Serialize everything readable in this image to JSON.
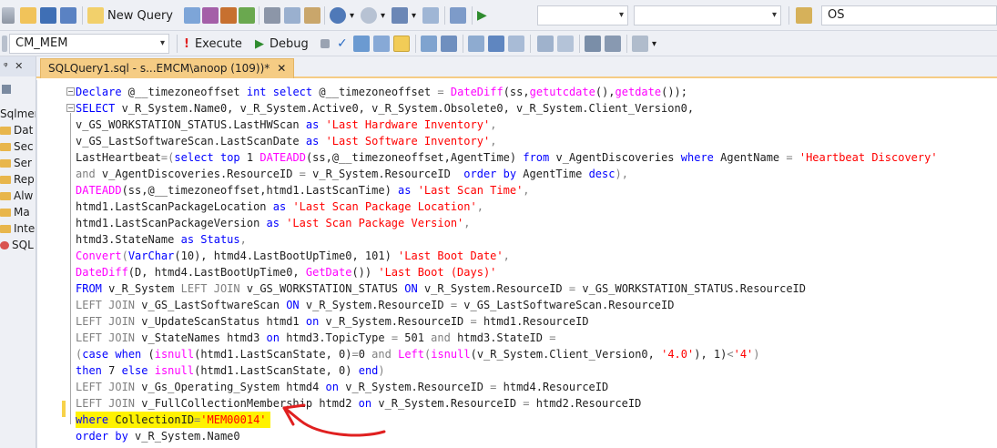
{
  "toolbar1": {
    "new_query_label": "New Query",
    "search_value": "OS"
  },
  "toolbar2": {
    "database_value": "CM_MEM",
    "execute_label": "Execute",
    "debug_label": "Debug"
  },
  "left_panel": {
    "items": [
      "Sqlmer",
      "Dat",
      "Sec",
      "Ser",
      "Rep",
      "Alw",
      "Ma",
      "Inte",
      "SQL"
    ]
  },
  "tab": {
    "title": "SQLQuery1.sql - s...EMCM\\anoop (109))*",
    "close": "✕"
  },
  "code": {
    "l1": [
      "Declare",
      " @__timezoneoffset ",
      "int",
      " ",
      "select",
      " @__timezoneoffset ",
      "=",
      " ",
      "DateDiff",
      "(ss,",
      "getutcdate",
      "(),",
      "getdate",
      "());"
    ],
    "l2": [
      "SELECT",
      " v_R_System.Name0, v_R_System.Active0, v_R_System.Obsolete0, v_R_System.Client_Version0,"
    ],
    "l3": [
      "v_GS_WORKSTATION_STATUS.LastHWScan ",
      "as",
      " ",
      "'Last Hardware Inventory'",
      ","
    ],
    "l4": [
      "v_GS_LastSoftwareScan.LastScanDate ",
      "as",
      " ",
      "'Last Software Inventory'",
      ","
    ],
    "l5": [
      "LastHeartbeat",
      "=",
      "(",
      "select",
      " ",
      "top",
      " 1 ",
      "DATEADD",
      "(ss,@__timezoneoffset,AgentTime) ",
      "from",
      " v_AgentDiscoveries ",
      "where",
      " AgentName ",
      "=",
      " ",
      "'Heartbeat Discovery'"
    ],
    "l6": [
      "and",
      " v_AgentDiscoveries.ResourceID ",
      "=",
      " v_R_System.ResourceID  ",
      "order by",
      " AgentTime ",
      "desc",
      "),"
    ],
    "l7": [
      "DATEADD",
      "(ss,@__timezoneoffset,htmd1.LastScanTime) ",
      "as",
      " ",
      "'Last Scan Time'",
      ","
    ],
    "l8": [
      "htmd1.LastScanPackageLocation ",
      "as",
      " ",
      "'Last Scan Package Location'",
      ","
    ],
    "l9": [
      "htmd1.LastScanPackageVersion ",
      "as",
      " ",
      "'Last Scan Package Version'",
      ","
    ],
    "l10": [
      "htmd3.StateName ",
      "as",
      " ",
      "Status",
      ","
    ],
    "l11": [
      "Convert",
      "(",
      "VarChar",
      "(10), htmd4.LastBootUpTime0, 101) ",
      "'Last Boot Date'",
      ","
    ],
    "l12": [
      "DateDiff",
      "(D, htmd4.LastBootUpTime0, ",
      "GetDate",
      "()) ",
      "'Last Boot (Days)'"
    ],
    "l13": [
      "FROM",
      " v_R_System ",
      "LEFT JOIN",
      " v_GS_WORKSTATION_STATUS ",
      "ON",
      " v_R_System.ResourceID ",
      "=",
      " v_GS_WORKSTATION_STATUS.ResourceID"
    ],
    "l14": [
      "LEFT JOIN",
      " v_GS_LastSoftwareScan ",
      "ON",
      " v_R_System.ResourceID ",
      "=",
      " v_GS_LastSoftwareScan.ResourceID"
    ],
    "l15": [
      "LEFT JOIN",
      " v_UpdateScanStatus htmd1 ",
      "on",
      " v_R_System.ResourceID ",
      "=",
      " htmd1.ResourceID"
    ],
    "l16": [
      "LEFT JOIN",
      " v_StateNames htmd3 ",
      "on",
      " htmd3.TopicType ",
      "=",
      " 501 ",
      "and",
      " htmd3.StateID ",
      "="
    ],
    "l17": [
      "(",
      "case",
      " ",
      "when",
      " (",
      "isnull",
      "(htmd1.LastScanState, 0)",
      "=",
      "0 ",
      "and",
      " ",
      "Left",
      "(",
      "isnull",
      "(v_R_System.Client_Version0, ",
      "'4.0'",
      "), 1)",
      "<",
      "'4'",
      ")"
    ],
    "l18": [
      "then",
      " 7 ",
      "else",
      " ",
      "isnull",
      "(htmd1.LastScanState, 0) ",
      "end",
      ")"
    ],
    "l19": [
      "LEFT JOIN",
      " v_Gs_Operating_System htmd4 ",
      "on",
      " v_R_System.ResourceID ",
      "=",
      " htmd4.ResourceID"
    ],
    "l20": [
      "LEFT JOIN",
      " v_FullCollectionMembership htmd2 ",
      "on",
      " v_R_System.ResourceID ",
      "=",
      " htmd2.ResourceID"
    ],
    "l21": [
      "where",
      " CollectionID",
      "=",
      "'MEM00014'"
    ],
    "l22": [
      "order by",
      " v_R_System.Name0"
    ]
  },
  "colors": {
    "keyword": "#0000ff",
    "function": "#ff00ff",
    "string": "#ff0000",
    "operator": "#808080",
    "highlight": "#fff200",
    "annotation_arrow": "#e02020",
    "tab_active": "#f5cc84"
  }
}
